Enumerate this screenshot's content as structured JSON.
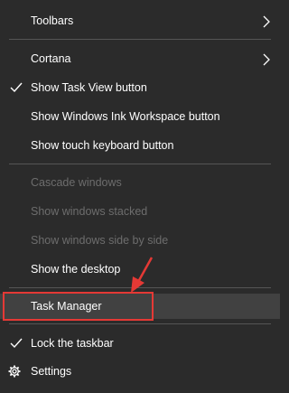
{
  "menu": {
    "items": {
      "toolbars": "Toolbars",
      "cortana": "Cortana",
      "show_task_view": "Show Task View button",
      "show_ink_workspace": "Show Windows Ink Workspace button",
      "show_touch_keyboard": "Show touch keyboard button",
      "cascade": "Cascade windows",
      "stacked": "Show windows stacked",
      "side_by_side": "Show windows side by side",
      "show_desktop": "Show the desktop",
      "task_manager": "Task Manager",
      "lock_taskbar": "Lock the taskbar",
      "settings": "Settings"
    },
    "icons": {
      "submenu": "chevron-right-icon",
      "checked": "checkmark-icon",
      "settings": "gear-icon",
      "annotation": "red-arrow-icon"
    }
  },
  "colors": {
    "background": "#2b2b2b",
    "text": "#ffffff",
    "disabled_text": "#6d6d6d",
    "separator": "#555555",
    "highlight": "#414141",
    "annotation": "#e53935"
  }
}
